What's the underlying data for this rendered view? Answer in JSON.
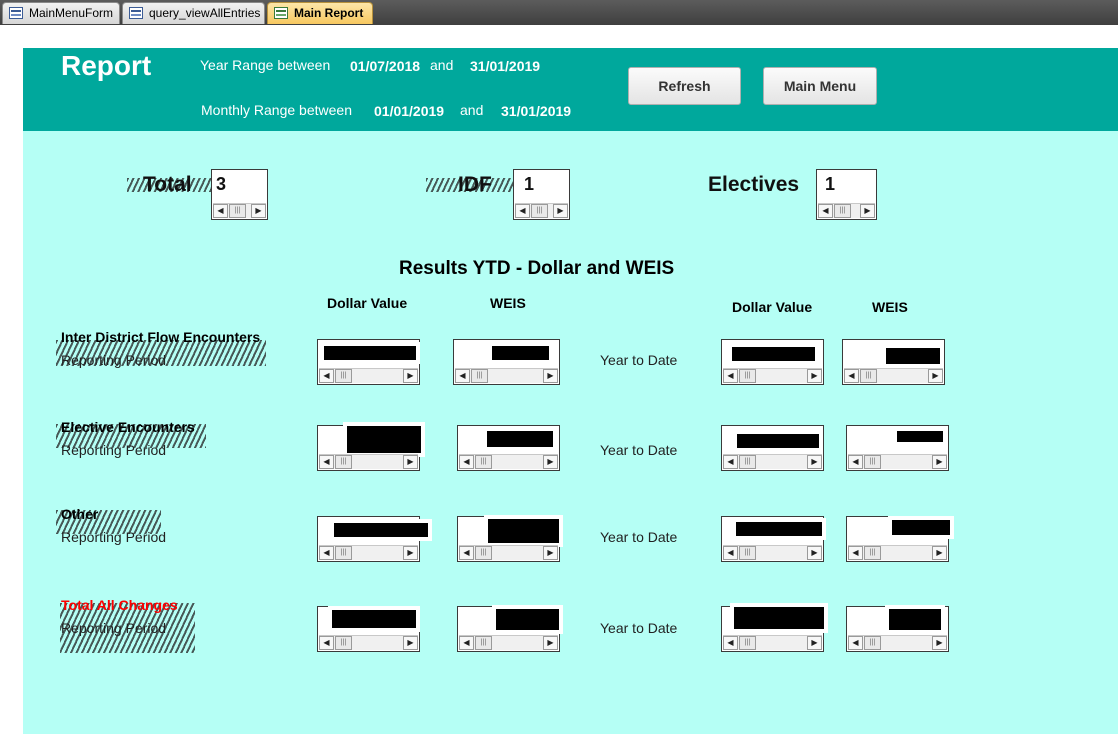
{
  "tabs": [
    {
      "label": "MainMenuForm",
      "icon": "form-icon"
    },
    {
      "label": "query_viewAllEntries",
      "icon": "query-icon"
    },
    {
      "label": "Main Report",
      "icon": "report-icon"
    }
  ],
  "header": {
    "title": "Report",
    "year_range_label": "Year Range between",
    "year_from": "01/07/2018",
    "year_and": "and",
    "year_to": "31/01/2019",
    "month_range_label": "Monthly Range between",
    "month_from": "01/01/2019",
    "month_and": "and",
    "month_to": "31/01/2019",
    "refresh_label": "Refresh",
    "main_menu_label": "Main Menu"
  },
  "counts": {
    "total_label": "Total",
    "total_value": "3",
    "idf_label": "IDF",
    "idf_value": "1",
    "electives_label": "Electives",
    "electives_value": "1"
  },
  "results": {
    "title": "Results YTD - Dollar and WEIS",
    "col_dollar": "Dollar Value",
    "col_weis": "WEIS",
    "year_to_date": "Year to Date",
    "reporting_period": "Reporting Period",
    "rows": [
      {
        "title": "Inter District Flow Encounters"
      },
      {
        "title": "Elective Encounters"
      },
      {
        "title": "Other"
      },
      {
        "title": "Total All Changes"
      }
    ]
  },
  "colors": {
    "header_bg": "#00a89c",
    "form_bg": "#b5fff5",
    "total_row_title": "#ff0000"
  }
}
